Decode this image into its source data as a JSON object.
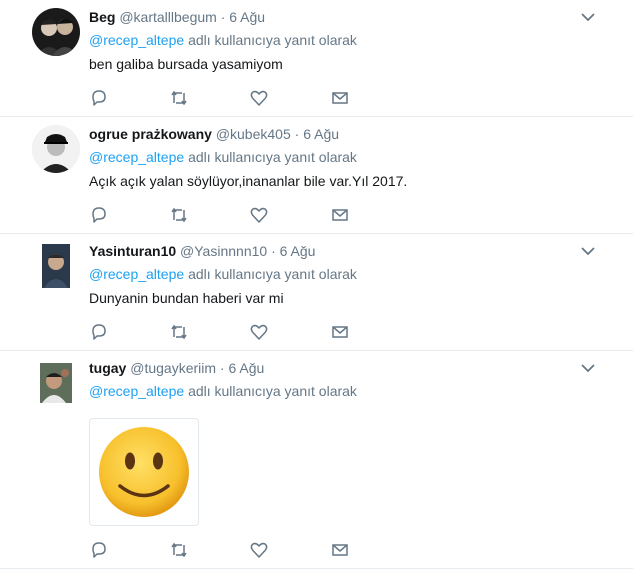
{
  "icons": {
    "menu": "chevron-down-icon",
    "reply": "reply-icon",
    "retweet": "retweet-icon",
    "like": "heart-icon",
    "dm": "envelope-icon"
  },
  "colors": {
    "link": "#1da1f2",
    "secondary": "#657786",
    "divider": "#e6ecf0"
  },
  "tweets": [
    {
      "name": "Beg",
      "handle": "@kartalllbegum",
      "separator": "·",
      "date": "6 Ağu",
      "reply_to": "@recep_altepe",
      "reply_suffix": "adlı kullanıcıya yanıt olarak",
      "text": "ben galiba bursada yasamiyom"
    },
    {
      "name": "ogrue prażkowany",
      "handle": "@kubek405",
      "separator": "·",
      "date": "6 Ağu",
      "reply_to": "@recep_altepe",
      "reply_suffix": "adlı kullanıcıya yanıt olarak",
      "text": "Açık açık yalan söylüyor,inananlar bile var.Yıl 2017."
    },
    {
      "name": "Yasinturan10",
      "handle": "@Yasinnnn10",
      "separator": "·",
      "date": "6 Ağu",
      "reply_to": "@recep_altepe",
      "reply_suffix": "adlı kullanıcıya yanıt olarak",
      "text": "Dunyanin bundan haberi var mi"
    },
    {
      "name": "tugay",
      "handle": "@tugaykeriim",
      "separator": "·",
      "date": "6 Ağu",
      "reply_to": "@recep_altepe",
      "reply_suffix": "adlı kullanıcıya yanıt olarak",
      "media": "slightly-smiling-face-emoji"
    }
  ]
}
